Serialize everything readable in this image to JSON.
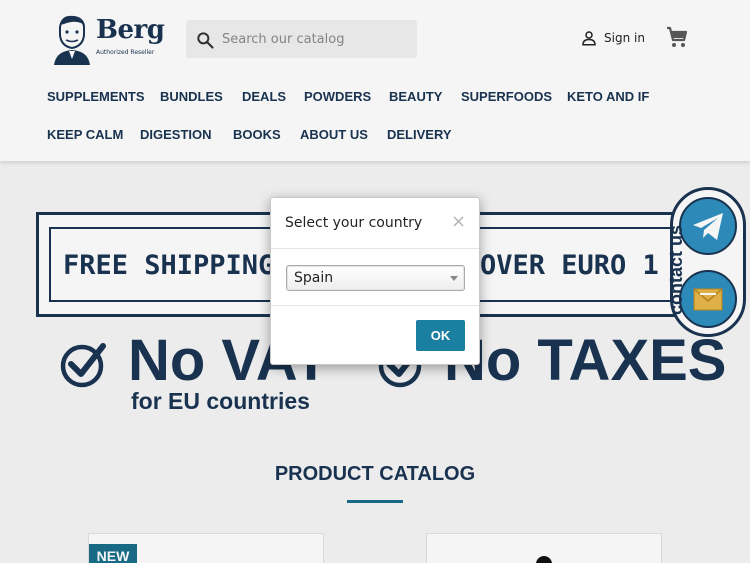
{
  "header": {
    "logo": {
      "word": "Berg",
      "subtitle": "Authorized Reseller"
    },
    "search": {
      "placeholder": "Search our catalog",
      "value": ""
    },
    "signin_label": "Sign in",
    "icons": {
      "search": "search-icon",
      "user": "user-icon",
      "cart": "cart-icon"
    }
  },
  "nav": {
    "row1": [
      "SUPPLEMENTS",
      "BUNDLES",
      "DEALS",
      "POWDERS",
      "BEAUTY",
      "SUPERFOODS",
      "KETO AND IF"
    ],
    "row2": [
      "KEEP CALM",
      "DIGESTION",
      "BOOKS",
      "ABOUT US",
      "DELIVERY"
    ]
  },
  "banner": {
    "shipping_left": "FREE SHIPPING",
    "shipping_right": "OVER EURO 1",
    "vat_main": "No VAT",
    "vat_sub": "for EU countries",
    "taxes_main": "No TAXES"
  },
  "contact": {
    "label": "contact us",
    "icons": [
      "telegram-icon",
      "mail-icon"
    ]
  },
  "catalog": {
    "title": "PRODUCT CATALOG",
    "badge": "NEW"
  },
  "modal": {
    "title": "Select your country",
    "close": "×",
    "selected_country": "Spain",
    "ok_label": "OK"
  },
  "colors": {
    "brand_navy": "#1b3553",
    "accent_teal": "#1a7fa0",
    "telegram_blue": "#2f8fbf"
  }
}
